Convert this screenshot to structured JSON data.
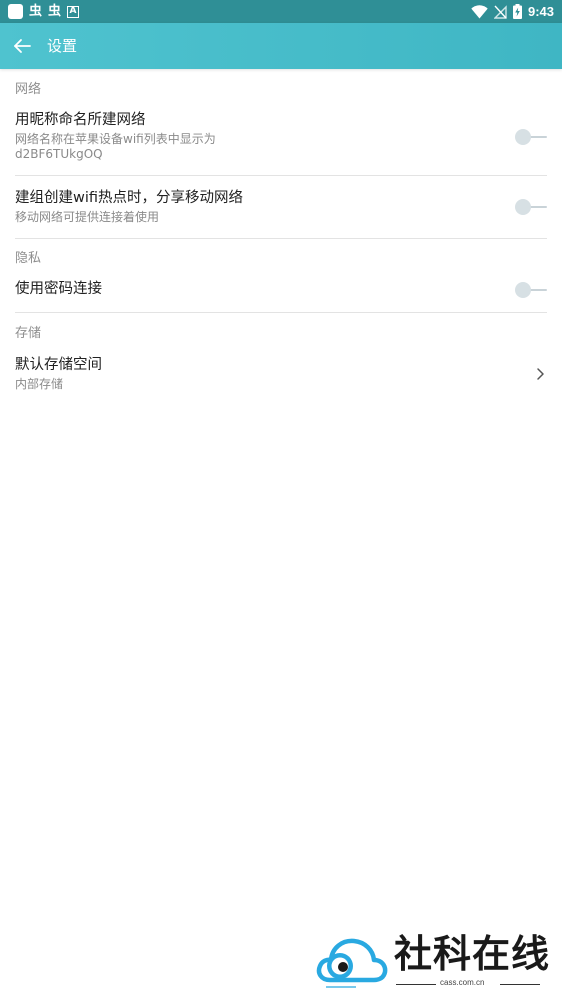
{
  "status_bar": {
    "left_glyphs": [
      "虫",
      "虫"
    ],
    "a_badge": "A",
    "time": "9:43"
  },
  "app_bar": {
    "title": "设置",
    "back_icon": "arrow-left-icon"
  },
  "sections": [
    {
      "header": "网络",
      "rows": [
        {
          "title": "用昵称命名所建网络",
          "subtitle_lines": [
            "网络名称在苹果设备wifi列表中显示为",
            "d2BF6TUkgOQ"
          ],
          "control": "toggle",
          "state": "off"
        },
        {
          "title": "建组创建wifi热点时，分享移动网络",
          "subtitle_lines": [
            "移动网络可提供连接着使用"
          ],
          "control": "toggle",
          "state": "off"
        }
      ]
    },
    {
      "header": "隐私",
      "rows": [
        {
          "title": "使用密码连接",
          "control": "toggle",
          "state": "off"
        }
      ]
    },
    {
      "header": "存储",
      "rows": [
        {
          "title": "默认存储空间",
          "subtitle_lines": [
            "内部存储"
          ],
          "control": "chevron"
        }
      ]
    }
  ],
  "watermark": {
    "text": "社科在线",
    "url": "cass.com.cn"
  },
  "colors": {
    "status_bar": "#2f8f96",
    "app_bar": "#45bcc9",
    "toggle_off": "#d7e0e4",
    "divider": "#e3e3e3",
    "watermark_accent": "#29a9e1"
  }
}
